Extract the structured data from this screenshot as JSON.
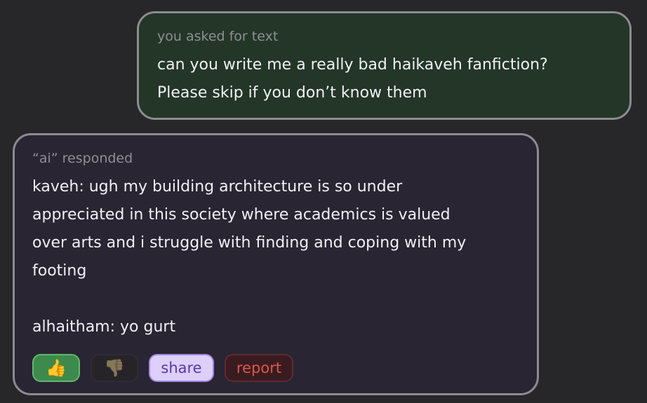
{
  "user_message": {
    "caption": "you asked for text",
    "text": "can you write me a really bad haikaveh fanfiction?\nPlease skip if you don’t know them"
  },
  "ai_message": {
    "caption": "“ai” responded",
    "text": "kaveh: ugh my building architecture is so under\nappreciated in this society where academics is valued\nover arts and i struggle with finding and coping with my\nfooting\n\nalhaitham: yo gurt"
  },
  "actions": {
    "thumbs_up_icon": "👍",
    "thumbs_down_icon": "👎",
    "share_label": "share",
    "report_label": "report"
  },
  "colors": {
    "background": "#272628",
    "user_bubble": "#233628",
    "ai_bubble": "#292533",
    "border": "#8c8c90",
    "thumbs_up_active": "#3d8a4c",
    "share_bg": "#dccff8",
    "report_text": "#d9574f"
  }
}
